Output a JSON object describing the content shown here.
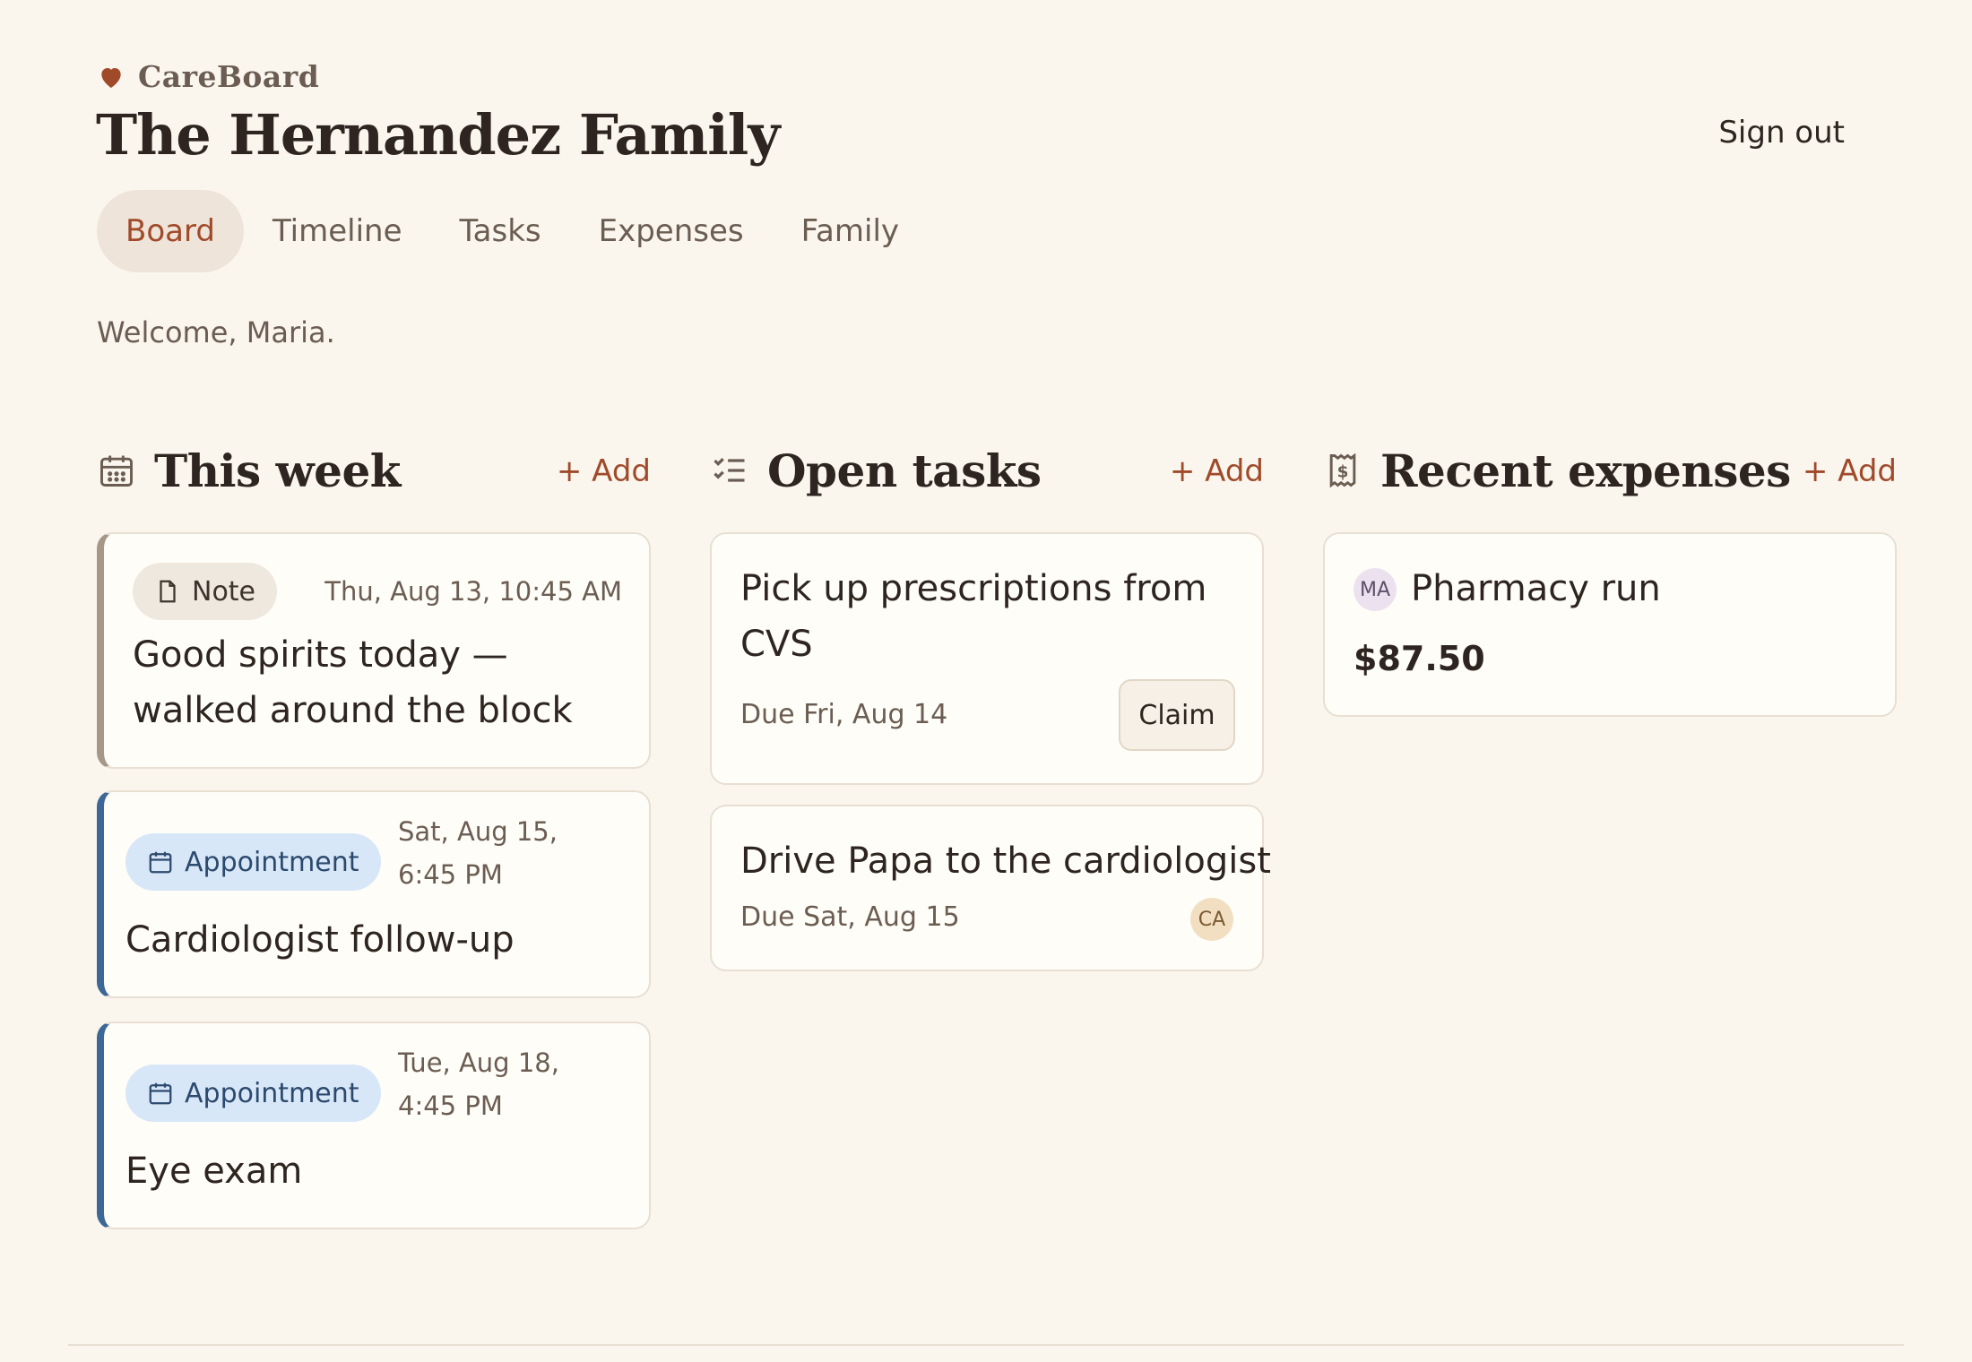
{
  "app": {
    "brand": "CareBoard",
    "title": "The Hernandez Family",
    "sign_out": "Sign out"
  },
  "nav": {
    "tabs": [
      "Board",
      "Timeline",
      "Tasks",
      "Expenses",
      "Family"
    ],
    "active": "Board"
  },
  "welcome": "Welcome, Maria.",
  "this_week": {
    "title": "This week",
    "add_label": "+ Add",
    "items": [
      {
        "kind": "Note",
        "when": "Thu, Aug 13, 10:45 AM",
        "text": "Good spirits today — walked around the block"
      },
      {
        "kind": "Appointment",
        "when": "Sat, Aug 15, 6:45 PM",
        "text": "Cardiologist follow-up"
      },
      {
        "kind": "Appointment",
        "when": "Tue, Aug 18, 4:45 PM",
        "text": "Eye exam"
      }
    ]
  },
  "open_tasks": {
    "title": "Open tasks",
    "add_label": "+ Add",
    "items": [
      {
        "title": "Pick up prescriptions from CVS",
        "due": "Due Fri, Aug 14",
        "action": "Claim"
      },
      {
        "title": "Drive Papa to the cardiologist",
        "due": "Due Sat, Aug 15",
        "assignee": "CA"
      }
    ]
  },
  "recent_expenses": {
    "title": "Recent expenses",
    "add_label": "+ Add",
    "items": [
      {
        "payer": "MA",
        "title": "Pharmacy run",
        "amount": "$87.50"
      }
    ]
  },
  "colors": {
    "accent": "#a04a2a",
    "appointment": "#3d6797",
    "note": "#a59889",
    "background": "#faf6ee"
  },
  "icons": {
    "brand": "heart-icon",
    "this_week": "calendar-icon",
    "open_tasks": "checklist-icon",
    "recent_expenses": "receipt-icon",
    "note": "document-icon",
    "appointment": "calendar-icon"
  }
}
